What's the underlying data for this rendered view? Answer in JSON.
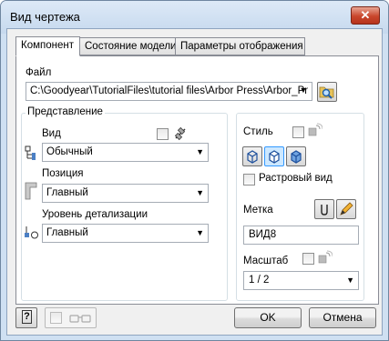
{
  "window": {
    "title": "Вид чертежа",
    "close_glyph": "✕"
  },
  "tabs": [
    {
      "label": "Компонент",
      "active": true
    },
    {
      "label": "Состояние модели",
      "active": false
    },
    {
      "label": "Параметры отображения",
      "active": false
    }
  ],
  "file": {
    "label": "Файл",
    "path": "C:\\Goodyear\\TutorialFiles\\tutorial files\\Arbor Press\\Arbor_Pr"
  },
  "representation": {
    "title": "Представление",
    "view": {
      "label": "Вид",
      "value": "Обычный",
      "checked": false
    },
    "position": {
      "label": "Позиция",
      "value": "Главный"
    },
    "lod": {
      "label": "Уровень детализации",
      "value": "Главный"
    }
  },
  "style": {
    "label": "Стиль",
    "checked": false,
    "raster": {
      "label": "Растровый вид",
      "checked": false
    }
  },
  "tag": {
    "label": "Метка",
    "value": "ВИД8"
  },
  "scale": {
    "label": "Масштаб",
    "value": "1 / 2",
    "checked": false
  },
  "footer": {
    "ok_label": "OK",
    "cancel_label": "Отмена",
    "help_glyph": "?"
  },
  "colors": {
    "accent": "#3399ff",
    "selected_style": "#cde8ff"
  }
}
